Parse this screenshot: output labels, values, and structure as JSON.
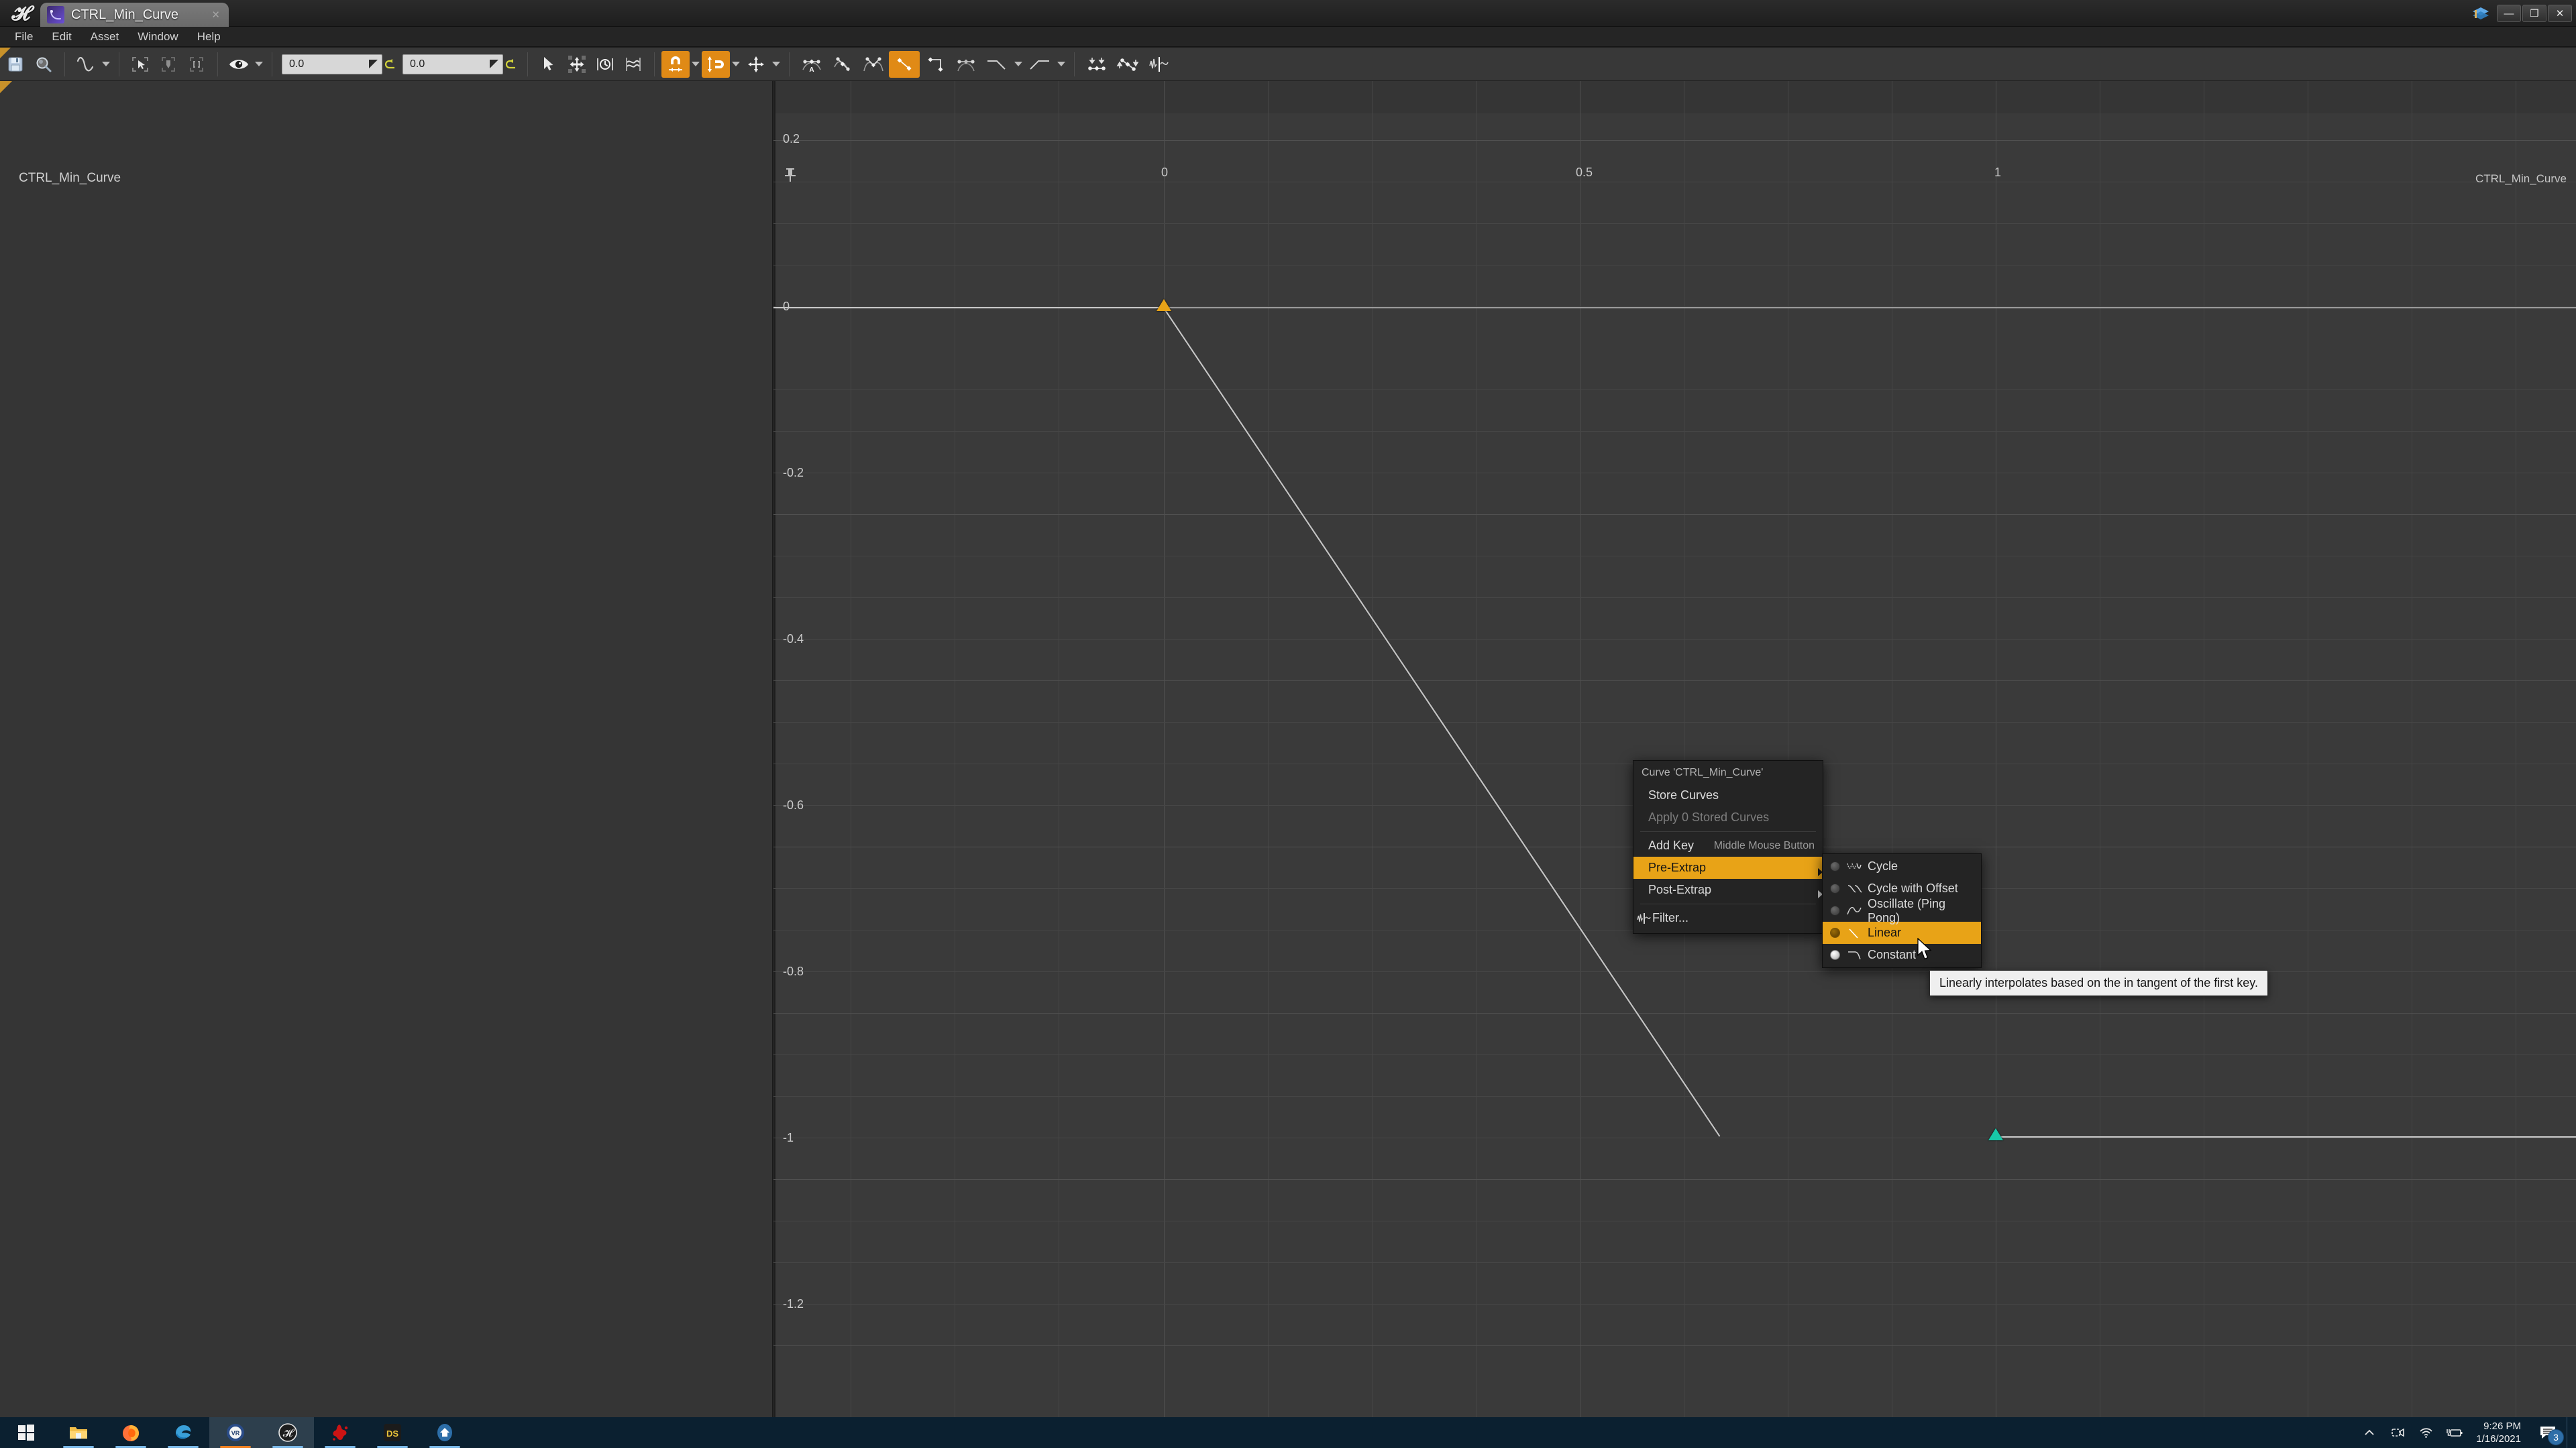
{
  "window": {
    "app_logo": "unreal-logo",
    "tab_title": "CTRL_Min_Curve",
    "tab_close": "×",
    "minimize": "—",
    "restore": "❐",
    "close": "✕"
  },
  "menubar": {
    "items": [
      {
        "label": "File"
      },
      {
        "label": "Edit"
      },
      {
        "label": "Asset"
      },
      {
        "label": "Window"
      },
      {
        "label": "Help"
      }
    ]
  },
  "toolbar": {
    "groups": [
      {
        "buttons": [
          {
            "name": "save-icon",
            "label": "Save",
            "active": false
          },
          {
            "name": "browse-icon",
            "label": "Find in Content Browser",
            "active": false
          }
        ]
      },
      {
        "buttons": [
          {
            "name": "curve-icon",
            "label": "Curve",
            "active": false,
            "caret": true
          }
        ]
      },
      {
        "buttons": [
          {
            "name": "select-box-icon",
            "label": "Select",
            "active": false
          },
          {
            "name": "key-box-icon",
            "label": "Key",
            "active": false
          },
          {
            "name": "range-box-icon",
            "label": "Range",
            "active": false
          }
        ]
      },
      {
        "buttons": [
          {
            "name": "visibility-eye-icon",
            "label": "Curve Visibility",
            "active": false,
            "caret": true
          }
        ]
      },
      {
        "fields": [
          {
            "name": "time-snap-value",
            "value": "0.0",
            "revert": "revert-icon"
          },
          {
            "name": "value-snap-value",
            "value": "0.0",
            "revert": "revert-icon"
          }
        ]
      },
      {
        "buttons": [
          {
            "name": "cursor-tool-icon",
            "label": "Select Tool",
            "active": false
          },
          {
            "name": "transform-tool-icon",
            "label": "Transform Tool",
            "active": false
          },
          {
            "name": "retime-tool-icon",
            "label": "Retime Tool",
            "active": false
          },
          {
            "name": "multi-curve-icon",
            "label": "Multi Curve",
            "active": false
          }
        ]
      },
      {
        "buttons": [
          {
            "name": "time-snap-magnet-icon",
            "label": "Time Snapping",
            "active": true,
            "caret": true
          },
          {
            "name": "value-snap-magnet-icon",
            "label": "Value Snapping",
            "active": true,
            "caret": true
          },
          {
            "name": "axis-snap-icon",
            "label": "Axis Snapping",
            "active": false,
            "caret": true
          }
        ]
      },
      {
        "buttons": [
          {
            "name": "tangent-auto-icon",
            "label": "Auto",
            "active": false
          },
          {
            "name": "tangent-user-icon",
            "label": "User",
            "active": false
          },
          {
            "name": "tangent-break-icon",
            "label": "Break",
            "active": false
          },
          {
            "name": "tangent-linear-icon",
            "label": "Linear",
            "active": true
          },
          {
            "name": "tangent-constant-icon",
            "label": "Constant",
            "active": false
          },
          {
            "name": "tangent-cubic-smartauto-icon",
            "label": "Cubic SmartAuto",
            "active": false
          },
          {
            "name": "pre-infinity-icon",
            "label": "Pre-Infinity",
            "active": false,
            "caret": true
          },
          {
            "name": "post-infinity-icon",
            "label": "Post-Infinity",
            "active": false,
            "caret": true
          }
        ]
      },
      {
        "buttons": [
          {
            "name": "flatten-tangents-icon",
            "label": "Flatten Tangents",
            "active": false
          },
          {
            "name": "straighten-tangents-icon",
            "label": "Straighten Tangents",
            "active": false
          },
          {
            "name": "filter-icon",
            "label": "Filter",
            "active": false
          }
        ]
      }
    ]
  },
  "graph": {
    "curve_label_left": "CTRL_Min_Curve",
    "curve_label_right": "CTRL_Min_Curve",
    "pin_icon": "pin-icon"
  },
  "chart_data": {
    "type": "line",
    "title": "CTRL_Min_Curve",
    "xlabel": "",
    "ylabel": "",
    "x_ticks": [
      "0",
      "0.5",
      "1"
    ],
    "x_tick_values": [
      0,
      0.5,
      1
    ],
    "y_ticks": [
      "0.2",
      "0",
      "-0.2",
      "-0.4",
      "-0.6",
      "-0.8",
      "-1",
      "-1.2"
    ],
    "y_tick_values": [
      0.2,
      0,
      -0.2,
      -0.4,
      -0.6,
      -0.8,
      -1,
      -1.2
    ],
    "xlim": [
      -0.45,
      1.35
    ],
    "ylim": [
      -1.32,
      0.3
    ],
    "grid": true,
    "legend": "none",
    "series": [
      {
        "name": "CTRL_Min_Curve",
        "color": "#c9c9c9",
        "interpolation": "linear",
        "points": [
          {
            "x": 0,
            "y": 0,
            "key_color": "#e8a317",
            "selected": true
          },
          {
            "x": 1,
            "y": -1,
            "key_color": "#18c8a8",
            "selected": false
          }
        ],
        "pre_extrapolation": "constant",
        "post_extrapolation": "constant"
      }
    ]
  },
  "context_menu": {
    "header": "Curve 'CTRL_Min_Curve'",
    "items": [
      {
        "label": "Store Curves",
        "enabled": true,
        "highlighted": false,
        "submenu": false,
        "shortcut": ""
      },
      {
        "label": "Apply 0 Stored Curves",
        "enabled": false,
        "highlighted": false,
        "submenu": false,
        "shortcut": ""
      },
      {
        "label": "Add Key",
        "enabled": true,
        "highlighted": false,
        "submenu": false,
        "shortcut": "Middle Mouse Button"
      },
      {
        "label": "Pre-Extrap",
        "enabled": true,
        "highlighted": true,
        "submenu": true,
        "shortcut": ""
      },
      {
        "label": "Post-Extrap",
        "enabled": true,
        "highlighted": false,
        "submenu": true,
        "shortcut": ""
      },
      {
        "label": "Filter...",
        "enabled": true,
        "highlighted": false,
        "submenu": false,
        "shortcut": "",
        "icon": "filter-icon"
      }
    ]
  },
  "submenu": {
    "items": [
      {
        "label": "Cycle",
        "selected": false,
        "highlighted": false,
        "icon": "cycle-curve-icon"
      },
      {
        "label": "Cycle with Offset",
        "selected": false,
        "highlighted": false,
        "icon": "cycle-offset-curve-icon"
      },
      {
        "label": "Oscillate (Ping Pong)",
        "selected": false,
        "highlighted": false,
        "icon": "oscillate-curve-icon"
      },
      {
        "label": "Linear",
        "selected": false,
        "highlighted": true,
        "icon": "linear-curve-icon"
      },
      {
        "label": "Constant",
        "selected": true,
        "highlighted": false,
        "icon": "constant-curve-icon"
      }
    ]
  },
  "tooltip": {
    "text": "Linearly interpolates based on the in tangent of the first key."
  },
  "taskbar": {
    "apps": [
      {
        "name": "start-button-icon",
        "label": "Start",
        "running": false,
        "active": false
      },
      {
        "name": "file-explorer-icon",
        "label": "File Explorer",
        "running": true,
        "active": false
      },
      {
        "name": "firefox-icon",
        "label": "Firefox",
        "running": true,
        "active": false
      },
      {
        "name": "edge-icon",
        "label": "Microsoft Edge",
        "running": true,
        "active": false
      },
      {
        "name": "vr-app-icon",
        "label": "VR",
        "running": true,
        "active": true
      },
      {
        "name": "unreal-engine-icon",
        "label": "Unreal Engine",
        "running": true,
        "active": true
      },
      {
        "name": "blood-splatter-icon",
        "label": "App",
        "running": true,
        "active": false
      },
      {
        "name": "ds-app-icon",
        "label": "DS",
        "running": true,
        "active": false
      },
      {
        "name": "home-app-icon",
        "label": "Home",
        "running": true,
        "active": false
      }
    ],
    "tray": [
      {
        "name": "show-hidden-icons-chevron",
        "label": "Show hidden icons"
      },
      {
        "name": "camera-icon",
        "label": "Camera"
      },
      {
        "name": "wifi-icon",
        "label": "Network"
      },
      {
        "name": "battery-charging-icon",
        "label": "Battery"
      }
    ],
    "clock": {
      "time": "9:26 PM",
      "date": "1/16/2021"
    },
    "notifications": {
      "count": "3",
      "icon": "notification-icon"
    }
  },
  "colors": {
    "accent_orange": "#e8a317",
    "key_selected": "#e8a317",
    "key_unselected": "#18c8a8",
    "curve_line": "#c9c9c9",
    "panel_bg": "#383838",
    "graph_bg": "#3a3a3a",
    "taskbar_bg": "#0b2030"
  }
}
